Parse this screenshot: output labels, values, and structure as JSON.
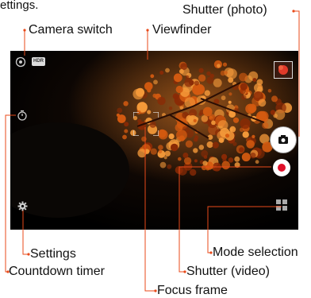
{
  "top_caption": "ettings.",
  "callouts": {
    "camera_switch": "Camera switch",
    "viewfinder": "Viewfinder",
    "shutter_photo": "Shutter (photo)",
    "settings": "Settings",
    "countdown_timer": "Countdown timer",
    "mode_selection": "Mode selection",
    "shutter_video": "Shutter (video)",
    "focus_frame": "Focus frame"
  },
  "screen": {
    "hdr_badge": "HDR",
    "icons": {
      "camera_switch": "camera-switch-icon",
      "timer": "timer-icon",
      "settings": "gear-icon",
      "photo_shutter": "camera-icon",
      "video_shutter": "record-icon",
      "mode": "grid-icon",
      "thumbnail": "gallery-thumbnail"
    },
    "colors": {
      "leaf_dark": "#8a2a05",
      "leaf_mid": "#d35a10",
      "leaf_light": "#f59a3a",
      "record_red": "#e0102a",
      "leader": "#e84a1a"
    }
  }
}
